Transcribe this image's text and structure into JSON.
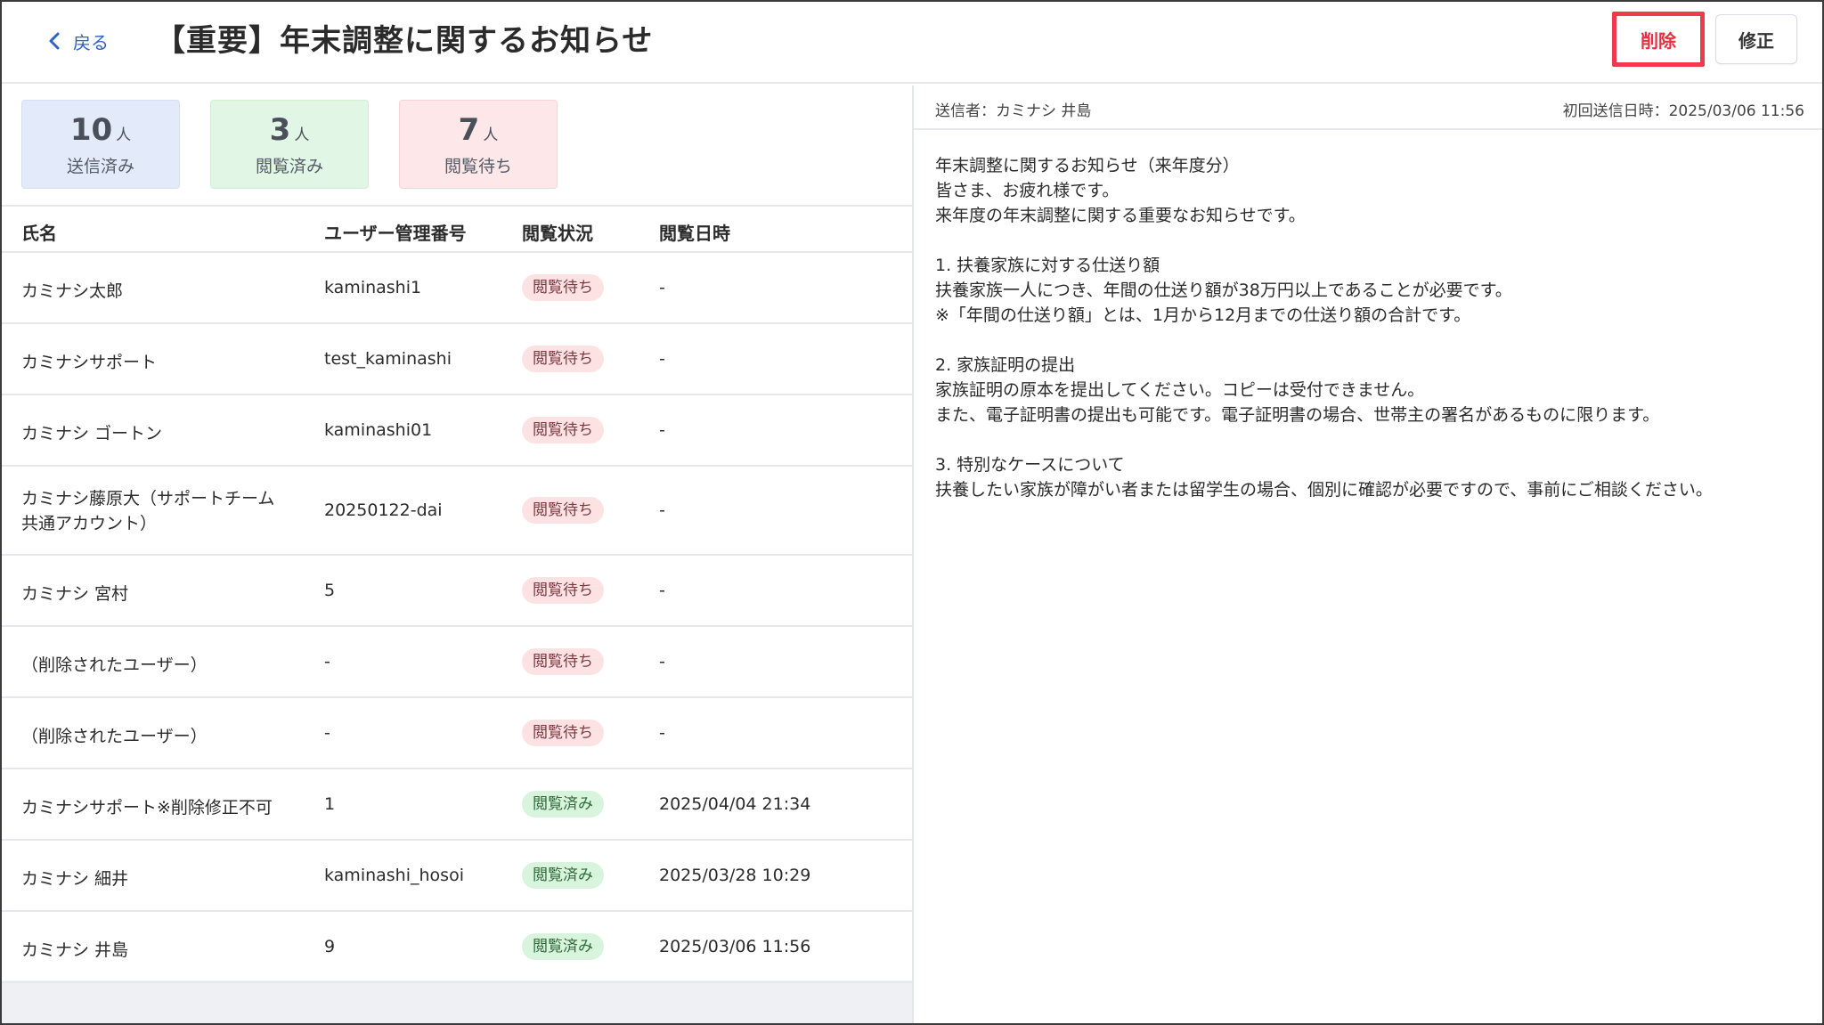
{
  "header": {
    "back_label": "戻る",
    "title": "【重要】年末調整に関するお知らせ",
    "delete_label": "削除",
    "edit_label": "修正"
  },
  "stats": {
    "sent": {
      "count": "10",
      "unit": "人",
      "label": "送信済み"
    },
    "read": {
      "count": "3",
      "unit": "人",
      "label": "閲覧済み"
    },
    "wait": {
      "count": "7",
      "unit": "人",
      "label": "閲覧待ち"
    }
  },
  "table": {
    "headers": {
      "name": "氏名",
      "id": "ユーザー管理番号",
      "status": "閲覧状況",
      "date": "閲覧日時"
    },
    "rows": [
      {
        "name": "カミナシ太郎",
        "id": "kaminashi1",
        "status": "閲覧待ち",
        "date": "-"
      },
      {
        "name": "カミナシサポート",
        "id": "test_kaminashi",
        "status": "閲覧待ち",
        "date": "-"
      },
      {
        "name": "カミナシ ゴートン",
        "id": "kaminashi01",
        "status": "閲覧待ち",
        "date": "-"
      },
      {
        "name": "カミナシ藤原大（サポートチーム共通アカウント）",
        "name_line1": "カミナシ藤原大（サポートチーム",
        "name_line2": "共通アカウント）",
        "id": "20250122-dai",
        "status": "閲覧待ち",
        "date": "-"
      },
      {
        "name": "カミナシ 宮村",
        "id": "5",
        "status": "閲覧待ち",
        "date": "-"
      },
      {
        "name": "（削除されたユーザー）",
        "id": "-",
        "status": "閲覧待ち",
        "date": "-"
      },
      {
        "name": "（削除されたユーザー）",
        "id": "-",
        "status": "閲覧待ち",
        "date": "-"
      },
      {
        "name": "カミナシサポート※削除修正不可",
        "id": "1",
        "status": "閲覧済み",
        "date": "2025/04/04 21:34"
      },
      {
        "name": "カミナシ 細井",
        "id": "kaminashi_hosoi",
        "status": "閲覧済み",
        "date": "2025/03/28 10:29"
      },
      {
        "name": "カミナシ 井島",
        "id": "9",
        "status": "閲覧済み",
        "date": "2025/03/06 11:56"
      }
    ]
  },
  "message": {
    "sender": "送信者：カミナシ 井島",
    "sent_at": "初回送信日時：2025/03/06 11:56",
    "lines": [
      "年末調整に関するお知らせ（来年度分）",
      "皆さま、お疲れ様です。",
      "来年度の年末調整に関する重要なお知らせです。",
      "",
      "1. 扶養家族に対する仕送り額",
      "扶養家族一人につき、年間の仕送り額が38万円以上であることが必要です。",
      "※「年間の仕送り額」とは、1月から12月までの仕送り額の合計です。",
      "",
      "2. 家族証明の提出",
      "家族証明の原本を提出してください。コピーは受付できません。",
      "また、電子証明書の提出も可能です。電子証明書の場合、世帯主の署名があるものに限ります。",
      "",
      "3. 特別なケースについて",
      "扶養したい家族が障がい者または留学生の場合、個別に確認が必要ですので、事前にご相談ください。"
    ]
  },
  "colors": {
    "accent": "#2f62c8",
    "delete": "#e8303f",
    "wait_badge": "#fde2e4",
    "read_badge": "#d8f4dc"
  }
}
